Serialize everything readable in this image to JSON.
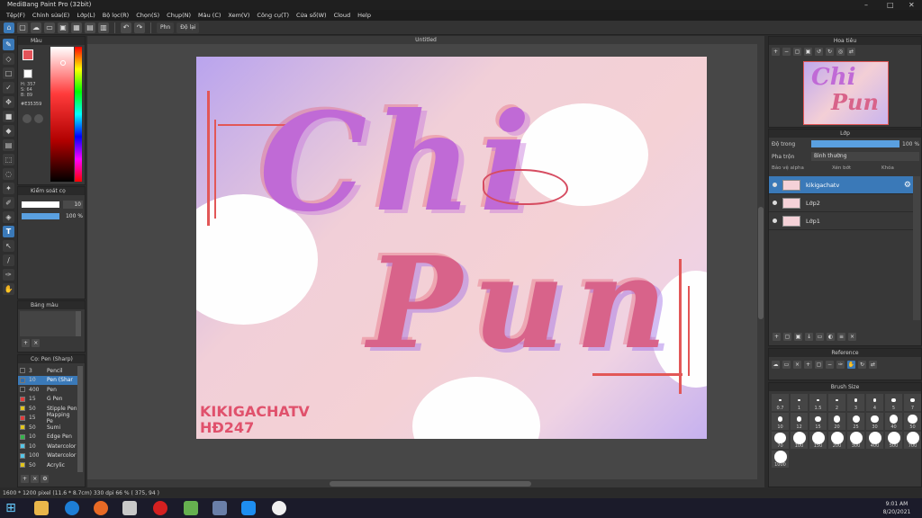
{
  "window": {
    "title": "MediBang Paint Pro (32bit)",
    "controls": [
      "–",
      "□",
      "✕"
    ]
  },
  "menu": [
    "Tệp(F)",
    "Chỉnh sửa(E)",
    "Lớp(L)",
    "Bộ lọc(R)",
    "Chọn(S)",
    "Chụp(N)",
    "Màu (C)",
    "Xem(V)",
    "Công cụ(T)",
    "Cửa sổ(W)",
    "Cloud",
    "Help"
  ],
  "toolbar": {
    "pen_chip": "Phn",
    "stabilizer_chip": "Độ lại"
  },
  "document_tab": "Untitled",
  "color_panel": {
    "title": "Màu",
    "hex": "#E35359",
    "hsv": "H: 357\nS: 64\nB: 89"
  },
  "brush_control": {
    "title": "Kiểm soát cọ",
    "size": "10",
    "opacity": "100 %"
  },
  "palette": {
    "title": "Bảng màu"
  },
  "brush_list": {
    "title": "Cọ: Pen (Sharp)",
    "items": [
      {
        "size": "3",
        "name": "Pencil",
        "color": "#333333"
      },
      {
        "size": "10",
        "name": "Pen (Shar",
        "color": "#2f6fb0",
        "selected": true
      },
      {
        "size": "400",
        "name": "Pen",
        "color": "#333333"
      },
      {
        "size": "15",
        "name": "G Pen",
        "color": "#e23b3b"
      },
      {
        "size": "50",
        "name": "Stipple Pen",
        "color": "#e2c51b"
      },
      {
        "size": "15",
        "name": "Mapping Pe",
        "color": "#e23b3b"
      },
      {
        "size": "50",
        "name": "Sumi",
        "color": "#e2c51b"
      },
      {
        "size": "10",
        "name": "Edge Pen",
        "color": "#33b34a"
      },
      {
        "size": "10",
        "name": "Watercolor",
        "color": "#54c6e8"
      },
      {
        "size": "100",
        "name": "Watercolor",
        "color": "#54c6e8"
      },
      {
        "size": "50",
        "name": "Acrylic",
        "color": "#e2c51b"
      }
    ]
  },
  "artwork": {
    "line1": "Chi",
    "line2": "Pun",
    "signature_1": "KIKIGACHATV",
    "signature_2": "HĐ247"
  },
  "navigator": {
    "title": "Hoa tiêu",
    "thumb_text_1": "Chi",
    "thumb_text_2": "Pun"
  },
  "layer_panel": {
    "title": "Lớp",
    "opacity_label": "Độ trong",
    "opacity_value": "100 %",
    "blend_label": "Pha trộn",
    "blend_value": "Bình thường",
    "protect_label": "Bảo vệ alpha",
    "clip_label": "Xén bớt",
    "lock_label": "Khóa",
    "layers": [
      {
        "name": "kikigachatv",
        "selected": true
      },
      {
        "name": "Lớp2",
        "selected": false
      },
      {
        "name": "Lớp1",
        "selected": false
      }
    ]
  },
  "reference_panel": {
    "title": "Reference"
  },
  "brush_size_panel": {
    "title": "Brush Size",
    "sizes": [
      "0.7",
      "1",
      "1.5",
      "2",
      "3",
      "4",
      "5",
      "7",
      "10",
      "12",
      "15",
      "20",
      "25",
      "30",
      "40",
      "50",
      "70",
      "100",
      "150",
      "200",
      "300",
      "400",
      "500",
      "700",
      "1000"
    ]
  },
  "status": {
    "text": "1600 * 1200 pixel  (11.6 * 8.7cm)  330 dpi  66 %  ( 375, 94 )"
  },
  "taskbar": {
    "time": "9:01 AM",
    "date": "8/20/2021"
  },
  "colors": {
    "accent": "#3a79b8",
    "primary": "#E35359"
  }
}
